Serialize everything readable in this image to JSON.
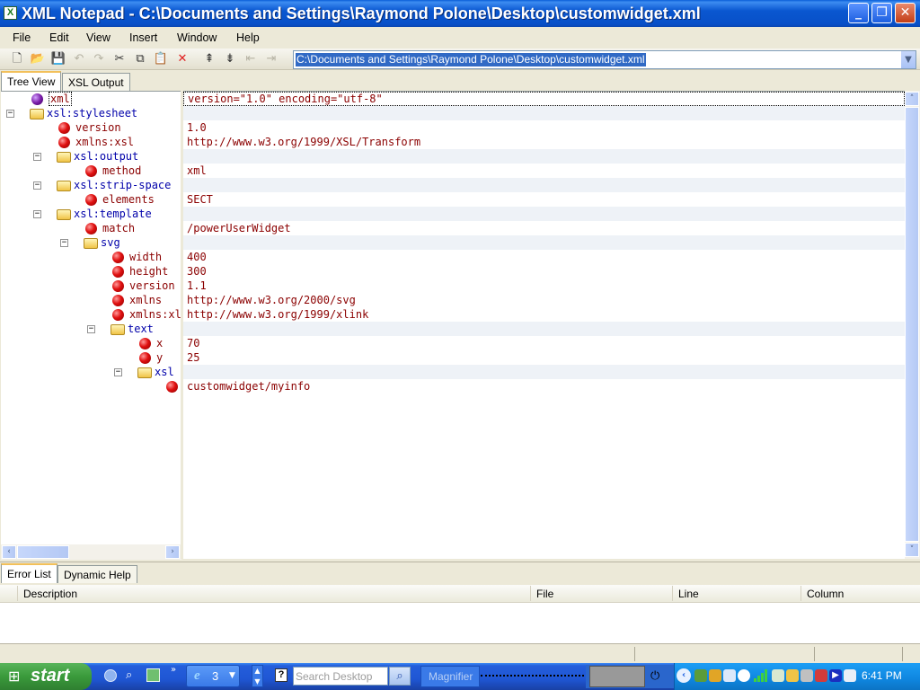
{
  "window": {
    "title": "XML Notepad - C:\\Documents and Settings\\Raymond Polone\\Desktop\\customwidget.xml",
    "app_icon_letter": "X",
    "minimize_glyph": "_",
    "maximize_glyph": "❐",
    "close_glyph": "✕"
  },
  "menu": [
    "File",
    "Edit",
    "View",
    "Insert",
    "Window",
    "Help"
  ],
  "toolbar": {
    "path_value": "C:\\Documents and Settings\\Raymond Polone\\Desktop\\customwidget.xml",
    "icons": [
      "new-file-icon",
      "open-folder-icon",
      "save-icon",
      "undo-icon",
      "redo-icon",
      "cut-icon",
      "copy-icon",
      "paste-icon",
      "delete-icon",
      "nudge-up-icon",
      "nudge-down-icon",
      "nudge-left-icon",
      "nudge-right-icon"
    ]
  },
  "tabs": [
    "Tree View",
    "XSL Output"
  ],
  "tree": [
    {
      "label": "xml",
      "value": "version=\"1.0\" encoding=\"utf-8\"",
      "kind": "pi",
      "depth": 0,
      "expander": ""
    },
    {
      "label": "xsl:stylesheet",
      "value": "",
      "kind": "element",
      "depth": 0,
      "expander": "-"
    },
    {
      "label": "version",
      "value": "1.0",
      "kind": "attr",
      "depth": 1,
      "expander": ""
    },
    {
      "label": "xmlns:xsl",
      "value": "http://www.w3.org/1999/XSL/Transform",
      "kind": "attr",
      "depth": 1,
      "expander": ""
    },
    {
      "label": "xsl:output",
      "value": "",
      "kind": "element",
      "depth": 1,
      "expander": "-"
    },
    {
      "label": "method",
      "value": "xml",
      "kind": "attr",
      "depth": 2,
      "expander": ""
    },
    {
      "label": "xsl:strip-space",
      "value": "",
      "kind": "element",
      "depth": 1,
      "expander": "-"
    },
    {
      "label": "elements",
      "value": "SECT",
      "kind": "attr",
      "depth": 2,
      "expander": ""
    },
    {
      "label": "xsl:template",
      "value": "",
      "kind": "element",
      "depth": 1,
      "expander": "-"
    },
    {
      "label": "match",
      "value": "/powerUserWidget",
      "kind": "attr",
      "depth": 2,
      "expander": ""
    },
    {
      "label": "svg",
      "value": "",
      "kind": "element",
      "depth": 2,
      "expander": "-"
    },
    {
      "label": "width",
      "value": "400",
      "kind": "attr",
      "depth": 3,
      "expander": ""
    },
    {
      "label": "height",
      "value": "300",
      "kind": "attr",
      "depth": 3,
      "expander": ""
    },
    {
      "label": "version",
      "value": "1.1",
      "kind": "attr",
      "depth": 3,
      "expander": ""
    },
    {
      "label": "xmlns",
      "value": "http://www.w3.org/2000/svg",
      "kind": "attr",
      "depth": 3,
      "expander": ""
    },
    {
      "label": "xmlns:xlink",
      "value": "http://www.w3.org/1999/xlink",
      "kind": "attr",
      "depth": 3,
      "expander": ""
    },
    {
      "label": "text",
      "value": "",
      "kind": "element",
      "depth": 3,
      "expander": "-"
    },
    {
      "label": "x",
      "value": "70",
      "kind": "attr",
      "depth": 4,
      "expander": ""
    },
    {
      "label": "y",
      "value": "25",
      "kind": "attr",
      "depth": 4,
      "expander": ""
    },
    {
      "label": "xsl",
      "value": "",
      "kind": "element",
      "depth": 4,
      "expander": "-"
    },
    {
      "label": "",
      "value": "customwidget/myinfo",
      "kind": "attr",
      "depth": 5,
      "expander": ""
    }
  ],
  "bottom_tabs": [
    "Error List",
    "Dynamic Help"
  ],
  "error_columns": [
    "Description",
    "File",
    "Line",
    "Column"
  ],
  "taskbar": {
    "start_label": "start",
    "ie_count": "3",
    "search_placeholder": "Search Desktop",
    "magnifier_label": "Magnifier",
    "clock": "6:41 PM"
  }
}
